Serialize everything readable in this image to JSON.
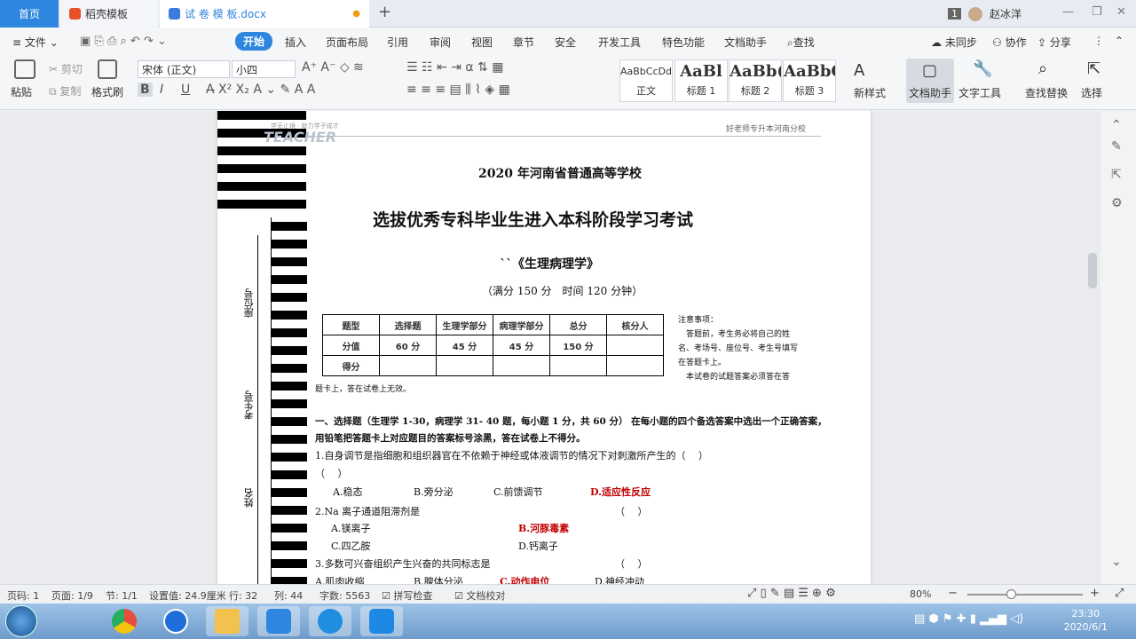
{
  "tabs": {
    "home": "首页",
    "daoke": "稻壳模板",
    "doc": "试 卷 模 板.docx"
  },
  "user": {
    "badge": "1",
    "name": "赵冰洋"
  },
  "menu": {
    "file": "文件",
    "items": [
      "开始",
      "插入",
      "页面布局",
      "引用",
      "审阅",
      "视图",
      "章节",
      "安全",
      "开发工具",
      "特色功能",
      "文档助手"
    ],
    "search": "查找",
    "sync": "未同步",
    "collab": "协作",
    "share": "分享"
  },
  "ribbon": {
    "paste": "粘贴",
    "cut": "剪切",
    "copy": "复制",
    "format_painter": "格式刷",
    "font": "宋体 (正文)",
    "size": "小四",
    "styles": [
      {
        "preview": "AaBbCcDd",
        "name": "正文"
      },
      {
        "preview": "AaBl",
        "name": "标题 1"
      },
      {
        "preview": "AaBb(",
        "name": "标题 2"
      },
      {
        "preview": "AaBbC",
        "name": "标题 3"
      }
    ],
    "new_style": "新样式",
    "doc_assistant": "文档助手",
    "text_tools": "文字工具",
    "find_replace": "查找替换",
    "select": "选择"
  },
  "document": {
    "logo_small": "学无止境 · 助力学子成才",
    "logo": "TEACHER",
    "header_right": "好老师专升本河南分校",
    "title1": "2020 年河南省普通高等学校",
    "title2": "选拔优秀专科毕业生进入本科阶段学习考试",
    "subject": "``《生理病理学》",
    "meta": "（满分 150 分　时间 120 分钟）",
    "side_labels": [
      "座位号",
      "考生号",
      "姓名"
    ],
    "score_table": [
      [
        "题型",
        "选择题",
        "生理学部分",
        "病理学部分",
        "总分",
        "核分人"
      ],
      [
        "分值",
        "60 分",
        "45 分",
        "45 分",
        "150 分",
        ""
      ],
      [
        "得分",
        "",
        "",
        "",
        "",
        ""
      ]
    ],
    "notice": [
      "注意事项：",
      "　答题前，考生务必将自己的姓",
      "名、考场号、座位号、考生号填写",
      "在答题卡上。",
      "　本试卷的试题答案必须答在答"
    ],
    "notice_tail": "题卡上，答在试卷上无效。",
    "section": "一、选择题（生理学 1-30，病理学 31- 40 题，每小题 1 分，共 60 分） 在每小题的四个备选答案中选出一个正确答案，",
    "section2": "用铅笔把答题卡上对应题目的答案标号涂黑，答在试卷上不得分。",
    "q1": "1.自身调节是指细胞和组织器官在不依赖于神经或体液调节的情况下对刺激所产生的（　 ）",
    "q1b": "（　 ）",
    "q1a": [
      "A.稳态",
      "B.旁分泌",
      "C.前馈调节",
      "D.适应性反应"
    ],
    "q2": "2.Na 离子通道阻滞剂是",
    "q2p": "（　 ）",
    "q2a": [
      "A.镁离子",
      "B.河豚毒素",
      "C.四乙胺",
      "D.钙离子"
    ],
    "q3": "3.多数可兴奋组织产生兴奋的共同标志是",
    "q3p": "（　 ）",
    "q3a": [
      "A.肌肉收缩",
      "B.腺体分泌",
      "C.动作电位",
      "D.神经冲动"
    ]
  },
  "status": {
    "page": "页码: 1",
    "pages": "页面: 1/9",
    "section": "节: 1/1",
    "setting": "设置值: 24.9厘米",
    "row": "行: 32",
    "col": "列: 44",
    "words": "字数: 5563",
    "spell": "拼写检查",
    "proof": "文档校对",
    "zoom": "80%"
  },
  "clock": {
    "time": "23:30",
    "date": "2020/6/1"
  },
  "colors": {
    "accent": "#2e86de",
    "answer": "#c00000"
  }
}
